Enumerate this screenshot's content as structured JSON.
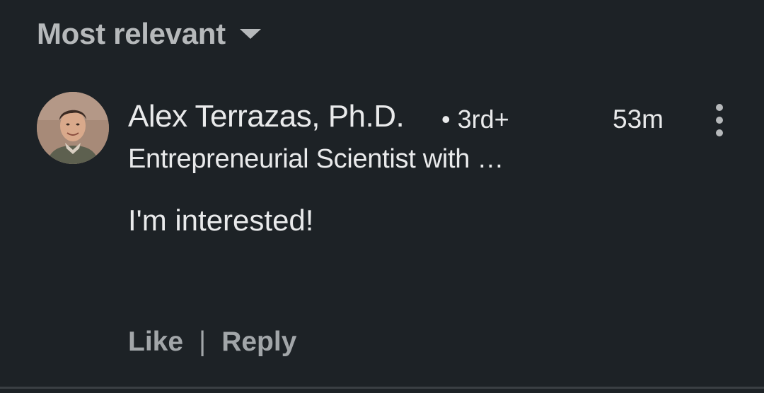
{
  "sort": {
    "label": "Most relevant",
    "icon": "caret-down-icon"
  },
  "comment": {
    "author": {
      "name": "Alex Terrazas, Ph.D.",
      "degree": "• 3rd+",
      "headline": "Entrepreneurial Scientist with …",
      "avatar_icon": "profile-photo"
    },
    "timestamp": "53m",
    "more_icon": "more-vertical-icon",
    "text": "I'm interested!",
    "actions": {
      "like": "Like",
      "separator": "|",
      "reply": "Reply"
    }
  },
  "colors": {
    "background": "#1d2226",
    "primary_text": "#e9eaeb",
    "secondary_text": "#b6b9bb",
    "action_text": "#a2a6a9"
  }
}
